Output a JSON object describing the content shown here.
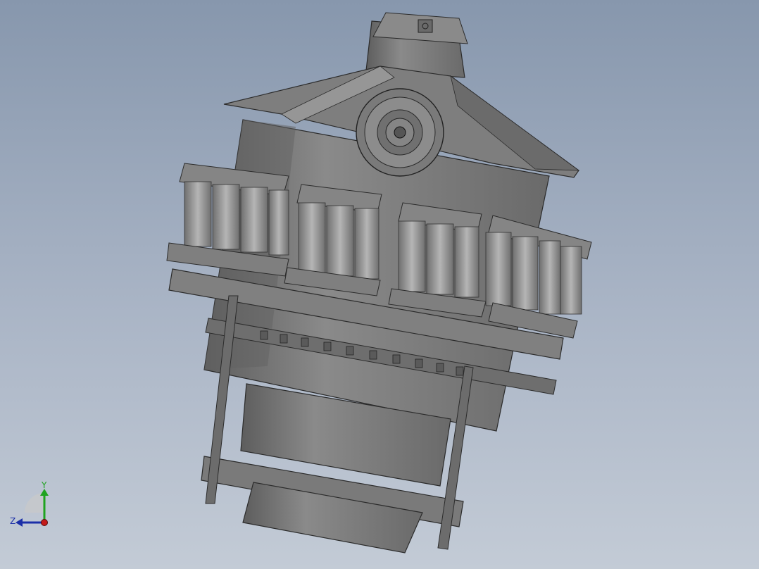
{
  "viewport": {
    "background_top": "#8797ad",
    "background_bottom": "#c3cbd6",
    "model": {
      "body_color": "#7c7c7c",
      "shadow_color": "#595959",
      "edge_color": "#2b2b2b",
      "highlight_color": "#a9a9a9",
      "spring_color": "#9a9a9a"
    }
  },
  "triad": {
    "y_label": "Y",
    "z_label": "Z",
    "y_color": "#1fa31f",
    "z_color": "#1b2fa8",
    "x_color": "#c41a1a"
  }
}
